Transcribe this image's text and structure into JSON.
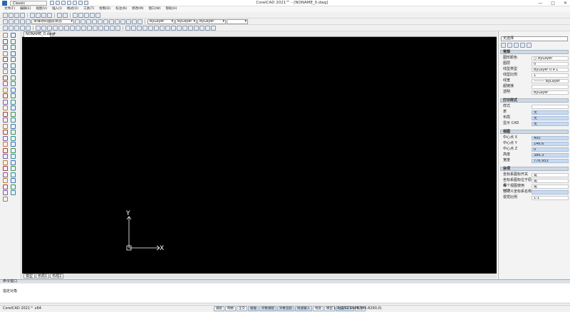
{
  "app": {
    "title": "CorelCAD 2021™ - [NONAME_0.dwg]",
    "workspace": "Classic"
  },
  "window_controls": [
    "—",
    "□",
    "✕"
  ],
  "menu": [
    "文件(F)",
    "编辑(E)",
    "视图(V)",
    "插入(I)",
    "格式(O)",
    "工具(T)",
    "绘制(D)",
    "标注(N)",
    "修改(M)",
    "窗口(W)",
    "帮助(H)"
  ],
  "toolbar2": {
    "layer_state": "未保存的图层状态",
    "color": "ByLayer",
    "linetype": "ByLayer",
    "lineweight": "ByLayer",
    "lineweight_short": "0.4 L"
  },
  "tabs": {
    "drawing": "NONAME_0.dwg",
    "add": "+"
  },
  "layout_tabs": [
    "模型",
    "布局1",
    "布局2"
  ],
  "command": {
    "header": "命令窗口",
    "prompt": "指定对角"
  },
  "status": {
    "version": "CorelCAD 2021™ x64",
    "buttons": [
      {
        "label": "捕捉",
        "on": false
      },
      {
        "label": "网格",
        "on": false
      },
      {
        "label": "正交",
        "on": false
      },
      {
        "label": "极轴",
        "on": true
      },
      {
        "label": "对象捕捉",
        "on": true
      },
      {
        "label": "对象追踪",
        "on": true
      },
      {
        "label": "快速输入",
        "on": true
      },
      {
        "label": "线宽",
        "on": false
      },
      {
        "label": "模型",
        "on": false
      },
      {
        "label": "动态 CCS",
        "on": true
      },
      {
        "label": "标注",
        "on": false
      }
    ],
    "coords": "1:1 (152.1489,546.8290,0)"
  },
  "properties": {
    "selection": "无选择",
    "sections": [
      {
        "title": "常规",
        "rows": [
          {
            "k": "图形颜色",
            "v": "○ ByLayer",
            "blue": false
          },
          {
            "k": "图层",
            "v": "0",
            "blue": false
          },
          {
            "k": "线型类型",
            "v": "ByLayer        0.4 L",
            "blue": false
          },
          {
            "k": "线型比例",
            "v": "1",
            "blue": false
          },
          {
            "k": "线宽",
            "v": "——— ByLayer",
            "blue": false
          },
          {
            "k": "超链接",
            "v": "",
            "blue": false
          },
          {
            "k": "透明",
            "v": "ByLayer",
            "blue": false
          }
        ]
      },
      {
        "title": "打印样式",
        "rows": [
          {
            "k": "样式",
            "v": "",
            "blue": false
          },
          {
            "k": "表",
            "v": "无",
            "blue": true
          },
          {
            "k": "布局",
            "v": "无",
            "blue": true
          },
          {
            "k": "显示 CAD",
            "v": "无",
            "blue": true
          }
        ]
      },
      {
        "title": "视图",
        "rows": [
          {
            "k": "中心点 X",
            "v": "400",
            "blue": true
          },
          {
            "k": "中心点 Y",
            "v": "146.6",
            "blue": true
          },
          {
            "k": "中心点 Z",
            "v": "0",
            "blue": true
          },
          {
            "k": "高度",
            "v": "386.3",
            "blue": true
          },
          {
            "k": "宽度",
            "v": "776.953",
            "blue": true
          }
        ]
      },
      {
        "title": "杂项",
        "rows": [
          {
            "k": "坐标系图标开关",
            "v": "是",
            "blue": false
          },
          {
            "k": "坐标系图标位于原点",
            "v": "是",
            "blue": false
          },
          {
            "k": "每个视图使用 UCS",
            "v": "是",
            "blue": false
          },
          {
            "k": "自定义坐标系名称",
            "v": "",
            "blue": true
          },
          {
            "k": "视觉比例",
            "v": "1:1",
            "blue": false
          }
        ]
      }
    ]
  },
  "ucs": {
    "x_label": "X",
    "y_label": "Y"
  },
  "colors": {
    "canvas": "#000000",
    "ucs": "#ffffff",
    "accent": "#cfe1f5"
  }
}
